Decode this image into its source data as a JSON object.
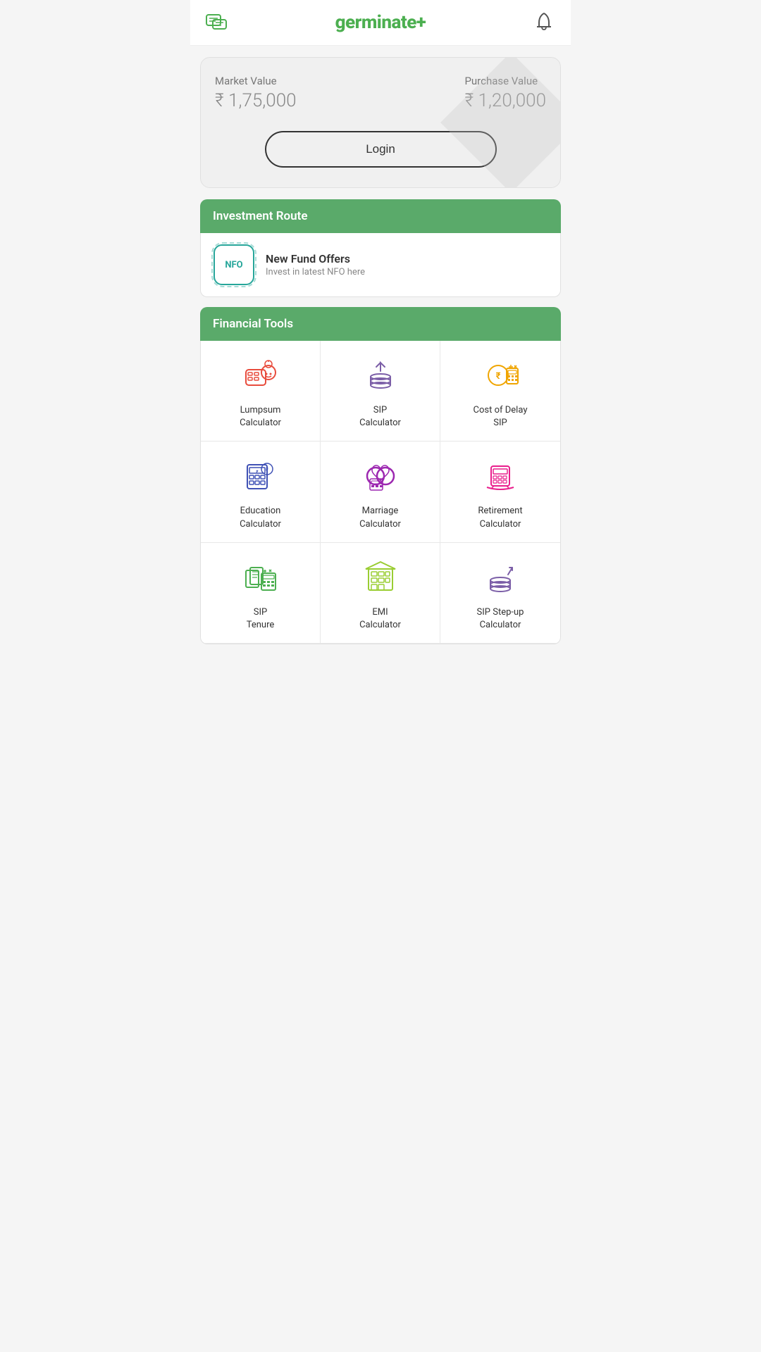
{
  "header": {
    "logo_text": "germinate",
    "logo_plus": "+",
    "chat_icon": "chat-icon",
    "bell_icon": "bell-icon"
  },
  "portfolio": {
    "market_value_label": "Market Value",
    "market_value": "₹ 1,75,000",
    "purchase_value_label": "Purchase Value",
    "purchase_value": "₹ 1,20,000",
    "login_button": "Login"
  },
  "investment_route": {
    "section_title": "Investment Route",
    "nfo_badge": "NFO",
    "nfo_title": "New Fund Offers",
    "nfo_subtitle": "Invest in latest NFO here"
  },
  "financial_tools": {
    "section_title": "Financial Tools",
    "tools": [
      {
        "id": "lumpsum-calculator",
        "label": "Lumpsum\nCalculator",
        "color": "#e84c3d"
      },
      {
        "id": "sip-calculator",
        "label": "SIP\nCalculator",
        "color": "#7b5ea7"
      },
      {
        "id": "cost-of-delay-sip",
        "label": "Cost of Delay\nSIP",
        "color": "#f0a500"
      },
      {
        "id": "education-calculator",
        "label": "Education\nCalculator",
        "color": "#3f51b5"
      },
      {
        "id": "marriage-calculator",
        "label": "Marriage\nCalculator",
        "color": "#9c27b0"
      },
      {
        "id": "retirement-calculator",
        "label": "Retirement\nCalculator",
        "color": "#e91e8c"
      },
      {
        "id": "sip-tenure",
        "label": "SIP\nTenure",
        "color": "#4caf50"
      },
      {
        "id": "emi-calculator",
        "label": "EMI\nCalculator",
        "color": "#9acd32"
      },
      {
        "id": "sip-stepup-calculator",
        "label": "SIP Step-up\nCalculator",
        "color": "#7b5ea7"
      }
    ]
  }
}
